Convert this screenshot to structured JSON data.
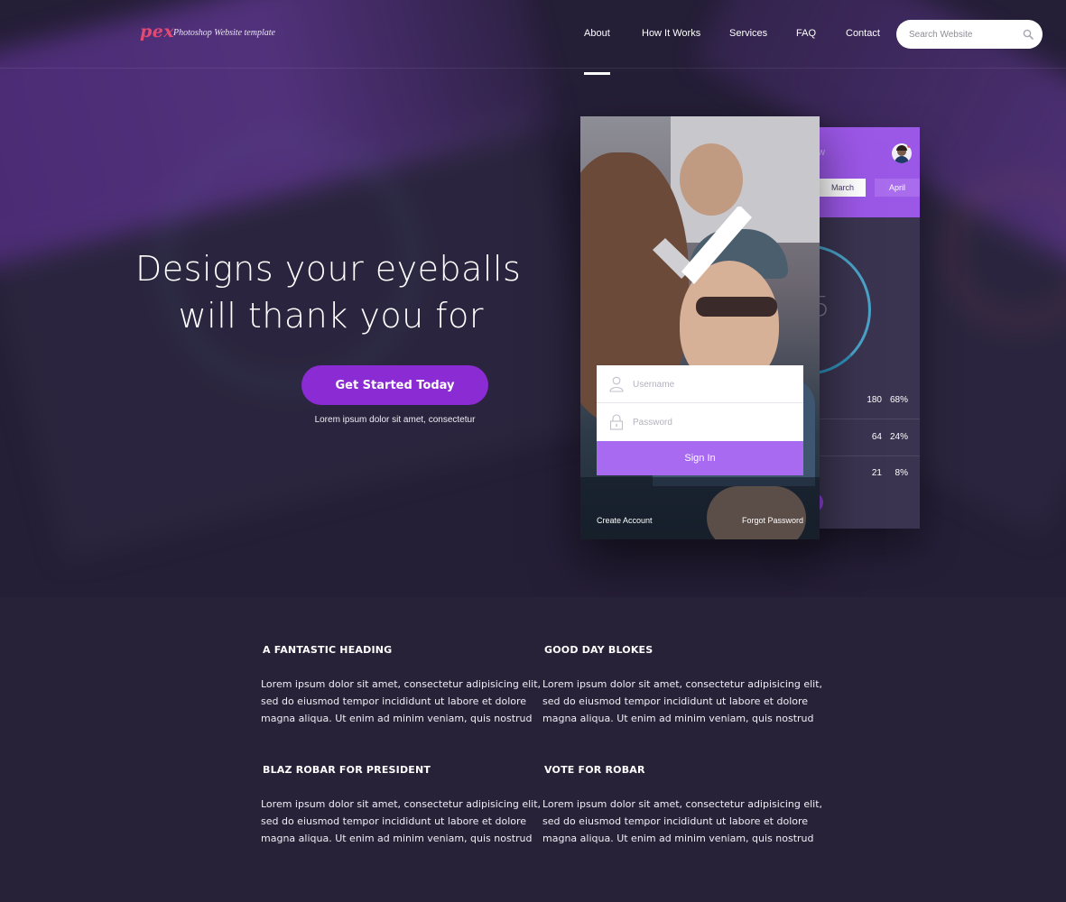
{
  "brand": {
    "logo": "pex",
    "tagline": "Photoshop Website template",
    "accent_color": "#8a2bd3",
    "logo_color": "#e24a73"
  },
  "nav": {
    "items": [
      {
        "label": "About",
        "active": true
      },
      {
        "label": "How It Works",
        "active": false
      },
      {
        "label": "Services",
        "active": false
      },
      {
        "label": "FAQ",
        "active": false
      },
      {
        "label": "Contact",
        "active": false
      }
    ],
    "search": {
      "placeholder": "Search Website",
      "value": "",
      "icon": "search-icon"
    }
  },
  "hero": {
    "headline_line1": "Designs your eyeballs",
    "headline_line2": "will thank you for",
    "cta_label": "Get Started Today",
    "cta_sub": "Lorem ipsum dolor sit amet, consectetur"
  },
  "stats_phone": {
    "title_fragment": "w",
    "months": [
      "March",
      "April"
    ],
    "gauge_value": "5",
    "rows": [
      {
        "value": "180",
        "percent": "68%"
      },
      {
        "value": "64",
        "percent": "24%"
      },
      {
        "value": "21",
        "percent": "8%"
      }
    ]
  },
  "login_phone": {
    "username_placeholder": "Username",
    "password_placeholder": "Password",
    "signin_label": "Sign In",
    "create_account": "Create Account",
    "forgot_password": "Forgot Password"
  },
  "features": [
    {
      "heading": "A FANTASTIC HEADING",
      "lines": [
        "Lorem ipsum dolor sit amet, consectetur adipisicing elit,",
        "sed do eiusmod tempor incididunt ut labore et dolore",
        "magna aliqua. Ut enim ad minim veniam, quis nostrud"
      ]
    },
    {
      "heading": "GOOD DAY BLOKES",
      "lines": [
        "Lorem ipsum dolor sit amet, consectetur adipisicing elit,",
        "sed do eiusmod tempor incididunt ut labore et dolore",
        "magna aliqua. Ut enim ad minim veniam, quis nostrud"
      ]
    },
    {
      "heading": "BLAZ ROBAR FOR PRESIDENT",
      "lines": [
        "Lorem ipsum dolor sit amet, consectetur adipisicing elit,",
        "sed do eiusmod tempor incididunt ut labore et dolore",
        "magna aliqua. Ut enim ad minim veniam, quis nostrud"
      ]
    },
    {
      "heading": "VOTE FOR ROBAR",
      "lines": [
        "Lorem ipsum dolor sit amet, consectetur adipisicing elit,",
        "sed do eiusmod tempor incididunt ut labore et dolore",
        "magna aliqua. Ut enim ad minim veniam, quis nostrud"
      ]
    }
  ]
}
